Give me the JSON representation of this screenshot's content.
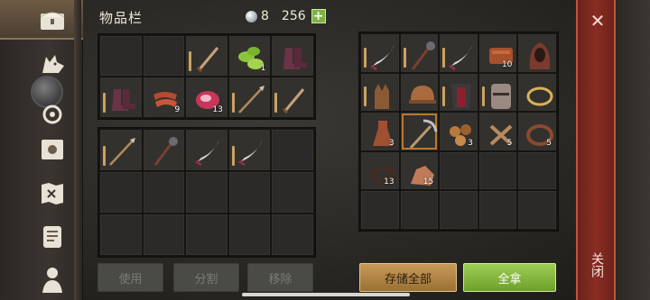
{
  "header": {
    "title": "物品栏",
    "coin_count": "8",
    "gold_count": "256",
    "plus_label": "+"
  },
  "sidebar": {
    "items": [
      {
        "name": "chest-icon"
      },
      {
        "name": "wolf-icon"
      },
      {
        "name": "crafting-icon"
      },
      {
        "name": "sun-icon"
      },
      {
        "name": "map-icon"
      },
      {
        "name": "scroll-icon"
      },
      {
        "name": "character-icon"
      }
    ]
  },
  "inventory": {
    "top_grid": [
      {
        "icon": "",
        "count": ""
      },
      {
        "icon": "",
        "count": ""
      },
      {
        "icon": "sword-icon",
        "count": "",
        "durability": true
      },
      {
        "icon": "herb-icon",
        "count": "1"
      },
      {
        "icon": "boots-icon",
        "count": ""
      },
      {
        "icon": "boots-icon",
        "count": "",
        "durability": true
      },
      {
        "icon": "bacon-icon",
        "count": "9"
      },
      {
        "icon": "raw-meat-icon",
        "count": "13"
      },
      {
        "icon": "spear-icon",
        "count": "",
        "durability": true
      },
      {
        "icon": "sword-icon",
        "count": "",
        "durability": true
      }
    ],
    "bottom_grid": [
      {
        "icon": "spear-icon",
        "count": "",
        "durability": true
      },
      {
        "icon": "mace-icon",
        "count": ""
      },
      {
        "icon": "scimitar-icon",
        "count": ""
      },
      {
        "icon": "scimitar-icon",
        "count": "",
        "durability": true
      },
      {
        "icon": "",
        "count": ""
      },
      {
        "icon": "",
        "count": ""
      },
      {
        "icon": "",
        "count": ""
      },
      {
        "icon": "",
        "count": ""
      },
      {
        "icon": "",
        "count": ""
      },
      {
        "icon": "",
        "count": ""
      },
      {
        "icon": "",
        "count": ""
      },
      {
        "icon": "",
        "count": ""
      },
      {
        "icon": "",
        "count": ""
      },
      {
        "icon": "",
        "count": ""
      },
      {
        "icon": "",
        "count": ""
      }
    ]
  },
  "storage": {
    "grid": [
      {
        "icon": "scimitar-icon",
        "count": "",
        "durability": true
      },
      {
        "icon": "mace-icon",
        "count": "",
        "durability": true
      },
      {
        "icon": "scimitar-icon",
        "count": "",
        "durability": true
      },
      {
        "icon": "leather-icon",
        "count": "10"
      },
      {
        "icon": "hood-icon",
        "count": ""
      },
      {
        "icon": "gloves-icon",
        "count": "",
        "durability": true
      },
      {
        "icon": "helmet-icon",
        "count": ""
      },
      {
        "icon": "chest-armor-icon",
        "count": "",
        "durability": true
      },
      {
        "icon": "great-helm-icon",
        "count": "",
        "durability": true
      },
      {
        "icon": "crown-icon",
        "count": ""
      },
      {
        "icon": "flask-icon",
        "count": "3"
      },
      {
        "icon": "pickaxe-icon",
        "count": "",
        "selected": true
      },
      {
        "icon": "stones-icon",
        "count": "3"
      },
      {
        "icon": "bones-icon",
        "count": "5"
      },
      {
        "icon": "rope-icon",
        "count": "5"
      },
      {
        "icon": "fiber-icon",
        "count": "13"
      },
      {
        "icon": "ore-icon",
        "count": "15"
      },
      {
        "icon": "",
        "count": ""
      },
      {
        "icon": "",
        "count": ""
      },
      {
        "icon": "",
        "count": ""
      },
      {
        "icon": "",
        "count": ""
      },
      {
        "icon": "",
        "count": ""
      },
      {
        "icon": "",
        "count": ""
      },
      {
        "icon": "",
        "count": ""
      },
      {
        "icon": "",
        "count": ""
      }
    ]
  },
  "buttons": {
    "use": "使用",
    "split": "分割",
    "remove": "移除",
    "store_all": "存储全部",
    "take_all": "全拿",
    "close": "关闭",
    "close_x": "✕"
  }
}
